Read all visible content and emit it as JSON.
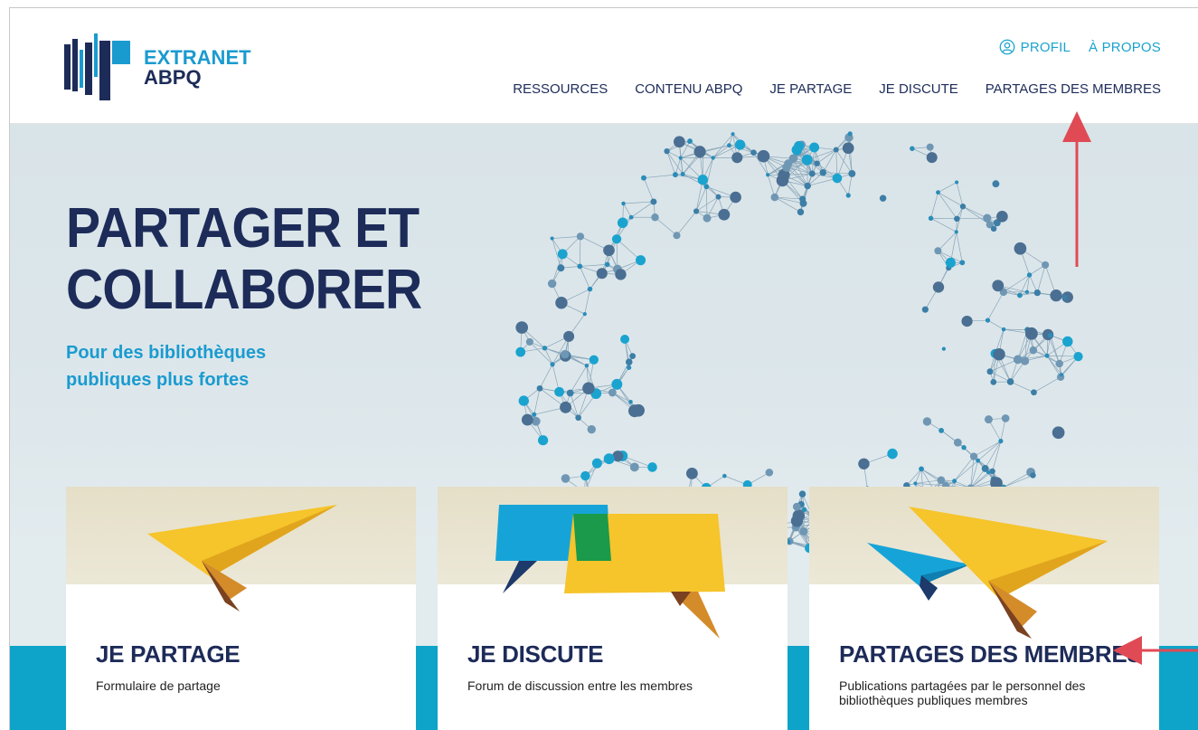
{
  "logo": {
    "line1": "EXTRANET",
    "line2": "ABPQ"
  },
  "util_nav": {
    "profile": "PROFIL",
    "about": "À PROPOS"
  },
  "nav": [
    "RESSOURCES",
    "CONTENU ABPQ",
    "JE PARTAGE",
    "JE DISCUTE",
    "PARTAGES DES MEMBRES"
  ],
  "hero": {
    "title_line1": "PARTAGER ET",
    "title_line2": "COLLABORER",
    "subtitle": "Pour des bibliothèques publiques plus fortes"
  },
  "cards": [
    {
      "title": "JE PARTAGE",
      "desc": "Formulaire de partage",
      "icon": "paper-plane-icon"
    },
    {
      "title": "JE DISCUTE",
      "desc": "Forum de discussion entre les membres",
      "icon": "speech-bubbles-icon"
    },
    {
      "title": "PARTAGES DES MEMBRES",
      "desc": "Publications partagées par le personnel des bibliothèques publiques membres",
      "icon": "paper-planes-icon"
    }
  ],
  "colors": {
    "navy": "#1d2b59",
    "cyan": "#1a9bd0",
    "band": "#0ea3c8",
    "annotation": "#e04a55"
  }
}
